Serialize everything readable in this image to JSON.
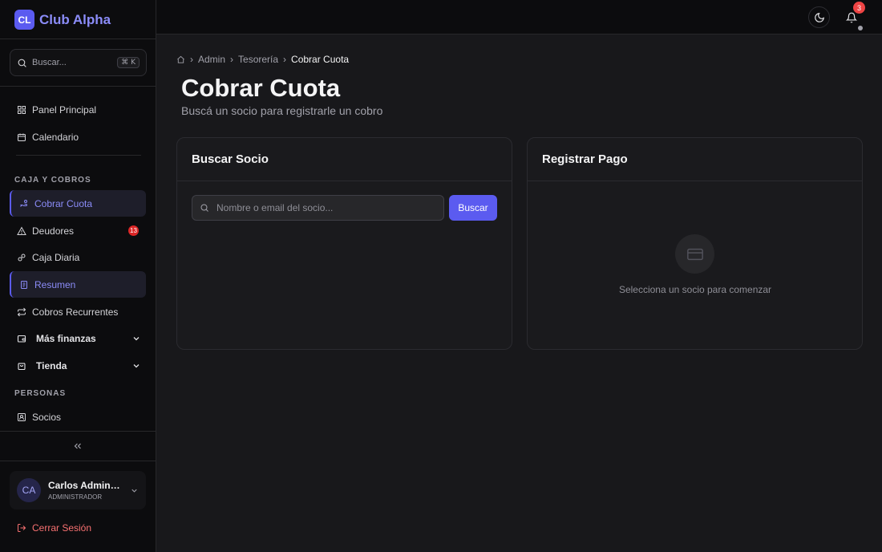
{
  "brand": {
    "logo_text": "CL",
    "name": "Club Alpha"
  },
  "search": {
    "placeholder": "Buscar...",
    "shortcut": "⌘ K"
  },
  "nav": {
    "top_items": [
      {
        "label": "Panel Principal",
        "icon": "grid-icon"
      },
      {
        "label": "Calendario",
        "icon": "calendar-icon"
      }
    ],
    "section_caja": "CAJA Y COBROS",
    "caja_items": [
      {
        "label": "Cobrar Cuota",
        "icon": "hand-coins-icon",
        "active": true
      },
      {
        "label": "Deudores",
        "icon": "warning-icon",
        "badge": "13"
      },
      {
        "label": "Caja Diaria",
        "icon": "wallet-icon"
      },
      {
        "label": "Resumen",
        "icon": "receipt-icon",
        "active": true
      },
      {
        "label": "Cobros Recurrentes",
        "icon": "repeat-icon"
      }
    ],
    "groups": [
      {
        "label": "Más finanzas",
        "icon": "wallet-icon"
      },
      {
        "label": "Tienda",
        "icon": "bag-icon"
      }
    ],
    "section_personas": "PERSONAS",
    "personas_items": [
      {
        "label": "Socios",
        "icon": "id-card-icon"
      }
    ]
  },
  "user": {
    "initials": "CA",
    "name": "Carlos Administrador",
    "role": "ADMINISTRADOR"
  },
  "logout_label": "Cerrar Sesión",
  "topbar": {
    "notification_count": "3"
  },
  "breadcrumb": {
    "items": [
      "Admin",
      "Tesorería"
    ],
    "current": "Cobrar Cuota"
  },
  "page": {
    "title": "Cobrar Cuota",
    "subtitle": "Buscá un socio para registrarle un cobro"
  },
  "search_card": {
    "title": "Buscar Socio",
    "input_placeholder": "Nombre o email del socio...",
    "button_label": "Buscar"
  },
  "payment_card": {
    "title": "Registrar Pago",
    "empty_text": "Selecciona un socio para comenzar"
  },
  "colors": {
    "accent": "#5b5bf0",
    "accent_text": "#8b8cf8",
    "danger": "#ef4444",
    "background": "#18181b",
    "sidebar": "#0c0c0e"
  }
}
